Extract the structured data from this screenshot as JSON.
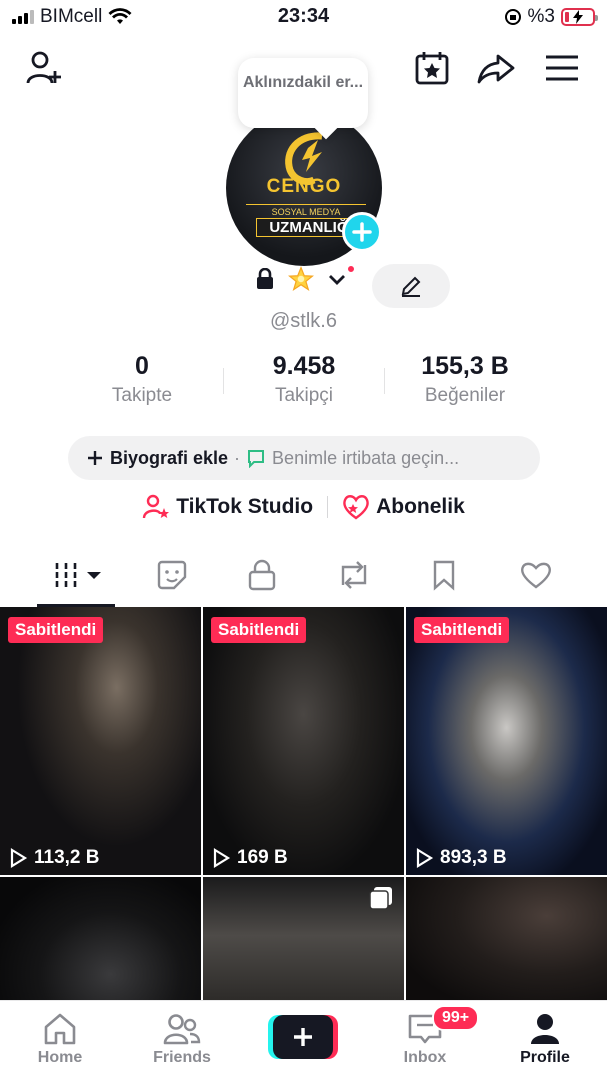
{
  "status_bar": {
    "carrier": "BIMcell",
    "time": "23:34",
    "battery": "%3"
  },
  "top_icons": [
    "add-user-icon",
    "calendar-star-icon",
    "share-icon",
    "menu-icon"
  ],
  "profile": {
    "note_bubble": "Aklınızdakil er...",
    "avatar_text": {
      "line1": "CENGO",
      "line2": "SOSYAL MEDYA",
      "line3": "UZMANLIĞI"
    },
    "username": "@stlk.6"
  },
  "stats": [
    {
      "value": "0",
      "label": "Takipte"
    },
    {
      "value": "9.458",
      "label": "Takipçi"
    },
    {
      "value": "155,3 B",
      "label": "Beğeniler"
    }
  ],
  "bio": {
    "add_label": "Biyografi ekle",
    "separator": "·",
    "contact_label": "Benimle irtibata geçin..."
  },
  "links": {
    "studio": "TikTok Studio",
    "subscription": "Abonelik"
  },
  "colors": {
    "accent": "#fe2c55",
    "cyan": "#20d5ec",
    "text": "#161823",
    "muted": "#8a8b91"
  },
  "videos": [
    {
      "pinned_label": "Sabitlendi",
      "views": "113,2 B"
    },
    {
      "pinned_label": "Sabitlendi",
      "views": "169 B"
    },
    {
      "pinned_label": "Sabitlendi",
      "views": "893,3 B"
    }
  ],
  "nav": {
    "home": "Home",
    "friends": "Friends",
    "inbox": "Inbox",
    "inbox_badge": "99+",
    "profile": "Profile"
  }
}
